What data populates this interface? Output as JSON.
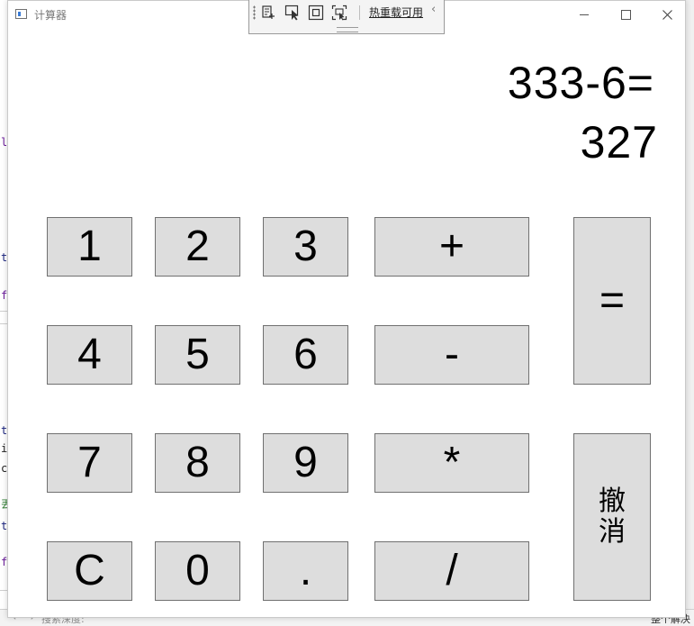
{
  "window": {
    "title": "计算器",
    "controls": {
      "minimize": "—",
      "maximize": "□",
      "close": "✕"
    }
  },
  "debug_toolbar": {
    "hot_reload_label": "热重载可用",
    "collapse": "‹",
    "icons": [
      "live-visual-tree-icon",
      "select-element-icon",
      "display-layout-adorners-icon",
      "track-focus-icon"
    ]
  },
  "display": {
    "expression": "333-6=",
    "result": "327"
  },
  "keys": {
    "k1": "1",
    "k2": "2",
    "k3": "3",
    "plus": "+",
    "k4": "4",
    "k5": "5",
    "k6": "6",
    "minus": "-",
    "k7": "7",
    "k8": "8",
    "k9": "9",
    "multiply": "*",
    "clear": "C",
    "k0": "0",
    "dot": ".",
    "divide": "/",
    "equals": "=",
    "cancel_line1": "撤",
    "cancel_line2": "消"
  },
  "background": {
    "left_chars": [
      "l",
      "t",
      "f",
      "t",
      "i",
      "c",
      "丟",
      "t",
      "f"
    ],
    "bottom_bar": {
      "arrows": "← →",
      "search_label": "搜索深度:",
      "right_text": "整个解决"
    }
  },
  "colors": {
    "key_face": "#dddddd",
    "key_border": "#707070",
    "window_bg": "#ffffff",
    "text": "#000000"
  }
}
